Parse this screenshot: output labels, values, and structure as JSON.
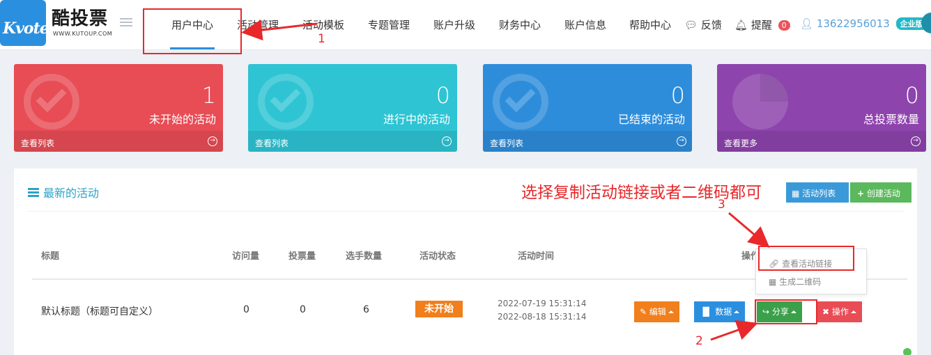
{
  "brand": {
    "logo_text": "Kvote",
    "name": "酷投票",
    "url": "WWW.KUTOUP.COM"
  },
  "nav": {
    "items": [
      "用户中心",
      "活动管理",
      "活动模板",
      "专题管理",
      "账户升级",
      "财务中心",
      "账户信息",
      "帮助中心"
    ],
    "active": "用户中心",
    "feedback": "反馈",
    "reminder": "提醒",
    "reminder_count": "0",
    "phone": "13622956013",
    "plan_badge": "企业版"
  },
  "stats": [
    {
      "value": "1",
      "label": "未开始的活动",
      "link": "查看列表",
      "color": "#e84c55"
    },
    {
      "value": "0",
      "label": "进行中的活动",
      "link": "查看列表",
      "color": "#2ec4d4"
    },
    {
      "value": "0",
      "label": "已结束的活动",
      "link": "查看列表",
      "color": "#2e8ddb"
    },
    {
      "value": "0",
      "label": "总投票数量",
      "link": "查看更多",
      "color": "#8e44ad"
    }
  ],
  "panel": {
    "title": "最新的活动",
    "btn_list": "活动列表",
    "btn_create": "创建活动",
    "columns": [
      "标题",
      "访问量",
      "投票量",
      "选手数量",
      "活动状态",
      "活动时间",
      "操作"
    ],
    "row": {
      "title": "默认标题（标题可自定义）",
      "visits": "0",
      "votes": "0",
      "players": "6",
      "status": "未开始",
      "start": "2022-07-19 15:31:14",
      "end": "2022-08-18 15:31:14"
    },
    "actions": {
      "edit": "编辑",
      "data": "数据",
      "share": "分享",
      "operate": "操作"
    },
    "share_menu": [
      "查看活动链接",
      "生成二维码"
    ]
  },
  "annotations": {
    "instruction": "选择复制活动链接或者二维码都可",
    "step1": "1",
    "step2": "2",
    "step3": "3",
    "color": "#e8282b"
  }
}
